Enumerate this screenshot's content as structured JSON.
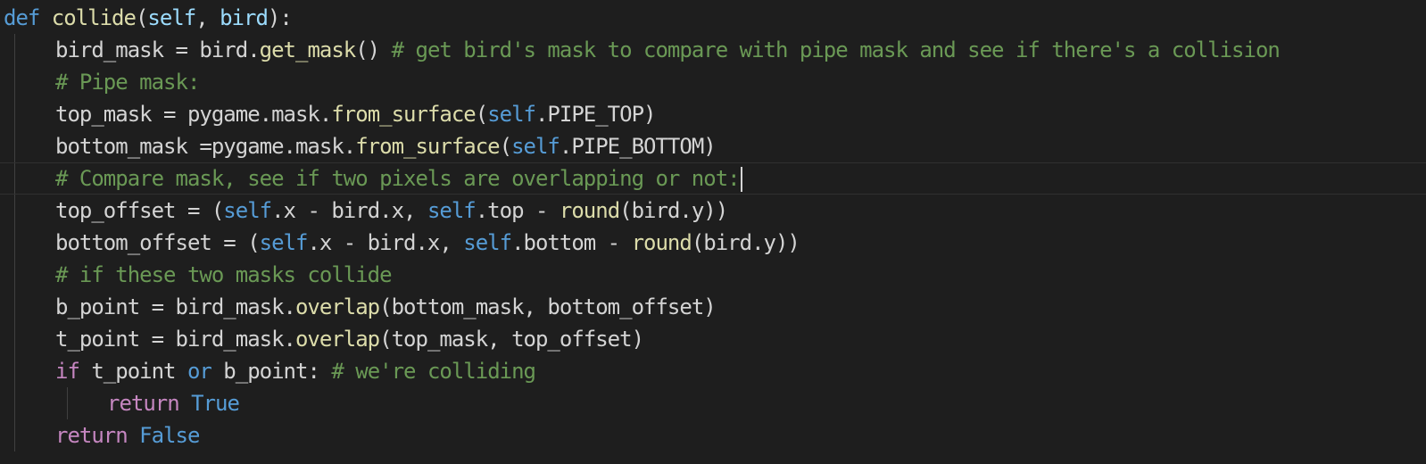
{
  "theme": {
    "background": "#1e1e1e",
    "default_text": "#d4d4d4",
    "keyword": "#569cd6",
    "control": "#c586c0",
    "function": "#dcdcaa",
    "parameter": "#9cdcfe",
    "comment": "#6a9955",
    "indent_guide": "#404040"
  },
  "cursor_line": 5,
  "lines": [
    {
      "indent": 0,
      "tokens": [
        {
          "t": "def ",
          "c": "kw"
        },
        {
          "t": "collide",
          "c": "fn"
        },
        {
          "t": "(",
          "c": "df"
        },
        {
          "t": "self",
          "c": "prm"
        },
        {
          "t": ", ",
          "c": "df"
        },
        {
          "t": "bird",
          "c": "prm"
        },
        {
          "t": "):",
          "c": "df"
        }
      ]
    },
    {
      "indent": 1,
      "tokens": [
        {
          "t": "bird_mask = bird.",
          "c": "df"
        },
        {
          "t": "get_mask",
          "c": "fn"
        },
        {
          "t": "() ",
          "c": "df"
        },
        {
          "t": "# get bird's mask to compare with pipe mask and see if there's a collision",
          "c": "cm"
        }
      ]
    },
    {
      "indent": 1,
      "tokens": [
        {
          "t": "# Pipe mask:",
          "c": "cm"
        }
      ]
    },
    {
      "indent": 1,
      "tokens": [
        {
          "t": "top_mask = pygame.mask.",
          "c": "df"
        },
        {
          "t": "from_surface",
          "c": "fn"
        },
        {
          "t": "(",
          "c": "df"
        },
        {
          "t": "self",
          "c": "kw"
        },
        {
          "t": ".PIPE_TOP)",
          "c": "df"
        }
      ]
    },
    {
      "indent": 1,
      "tokens": [
        {
          "t": "bottom_mask =pygame.mask.",
          "c": "df"
        },
        {
          "t": "from_surface",
          "c": "fn"
        },
        {
          "t": "(",
          "c": "df"
        },
        {
          "t": "self",
          "c": "kw"
        },
        {
          "t": ".PIPE_BOTTOM)",
          "c": "df"
        }
      ]
    },
    {
      "indent": 1,
      "tokens": [
        {
          "t": "# Compare mask, see if two pixels are overlapping or not:",
          "c": "cm"
        }
      ]
    },
    {
      "indent": 1,
      "tokens": [
        {
          "t": "top_offset = (",
          "c": "df"
        },
        {
          "t": "self",
          "c": "kw"
        },
        {
          "t": ".x - bird.x, ",
          "c": "df"
        },
        {
          "t": "self",
          "c": "kw"
        },
        {
          "t": ".top - ",
          "c": "df"
        },
        {
          "t": "round",
          "c": "fn"
        },
        {
          "t": "(bird.y))",
          "c": "df"
        }
      ]
    },
    {
      "indent": 1,
      "tokens": [
        {
          "t": "bottom_offset = (",
          "c": "df"
        },
        {
          "t": "self",
          "c": "kw"
        },
        {
          "t": ".x - bird.x, ",
          "c": "df"
        },
        {
          "t": "self",
          "c": "kw"
        },
        {
          "t": ".bottom - ",
          "c": "df"
        },
        {
          "t": "round",
          "c": "fn"
        },
        {
          "t": "(bird.y))",
          "c": "df"
        }
      ]
    },
    {
      "indent": 1,
      "tokens": [
        {
          "t": "# if these two masks collide",
          "c": "cm"
        }
      ]
    },
    {
      "indent": 1,
      "tokens": [
        {
          "t": "b_point = bird_mask.",
          "c": "df"
        },
        {
          "t": "overlap",
          "c": "fn"
        },
        {
          "t": "(bottom_mask, bottom_offset)",
          "c": "df"
        }
      ]
    },
    {
      "indent": 1,
      "tokens": [
        {
          "t": "t_point = bird_mask.",
          "c": "df"
        },
        {
          "t": "overlap",
          "c": "fn"
        },
        {
          "t": "(top_mask, top_offset)",
          "c": "df"
        }
      ]
    },
    {
      "indent": 1,
      "tokens": [
        {
          "t": "if",
          "c": "ctl"
        },
        {
          "t": " t_point ",
          "c": "df"
        },
        {
          "t": "or",
          "c": "kw"
        },
        {
          "t": " b_point: ",
          "c": "df"
        },
        {
          "t": "# we're colliding",
          "c": "cm"
        }
      ]
    },
    {
      "indent": 2,
      "tokens": [
        {
          "t": "return",
          "c": "ctl"
        },
        {
          "t": " ",
          "c": "df"
        },
        {
          "t": "True",
          "c": "kw"
        }
      ]
    },
    {
      "indent": 1,
      "tokens": [
        {
          "t": "return",
          "c": "ctl"
        },
        {
          "t": " ",
          "c": "df"
        },
        {
          "t": "False",
          "c": "kw"
        }
      ]
    }
  ]
}
